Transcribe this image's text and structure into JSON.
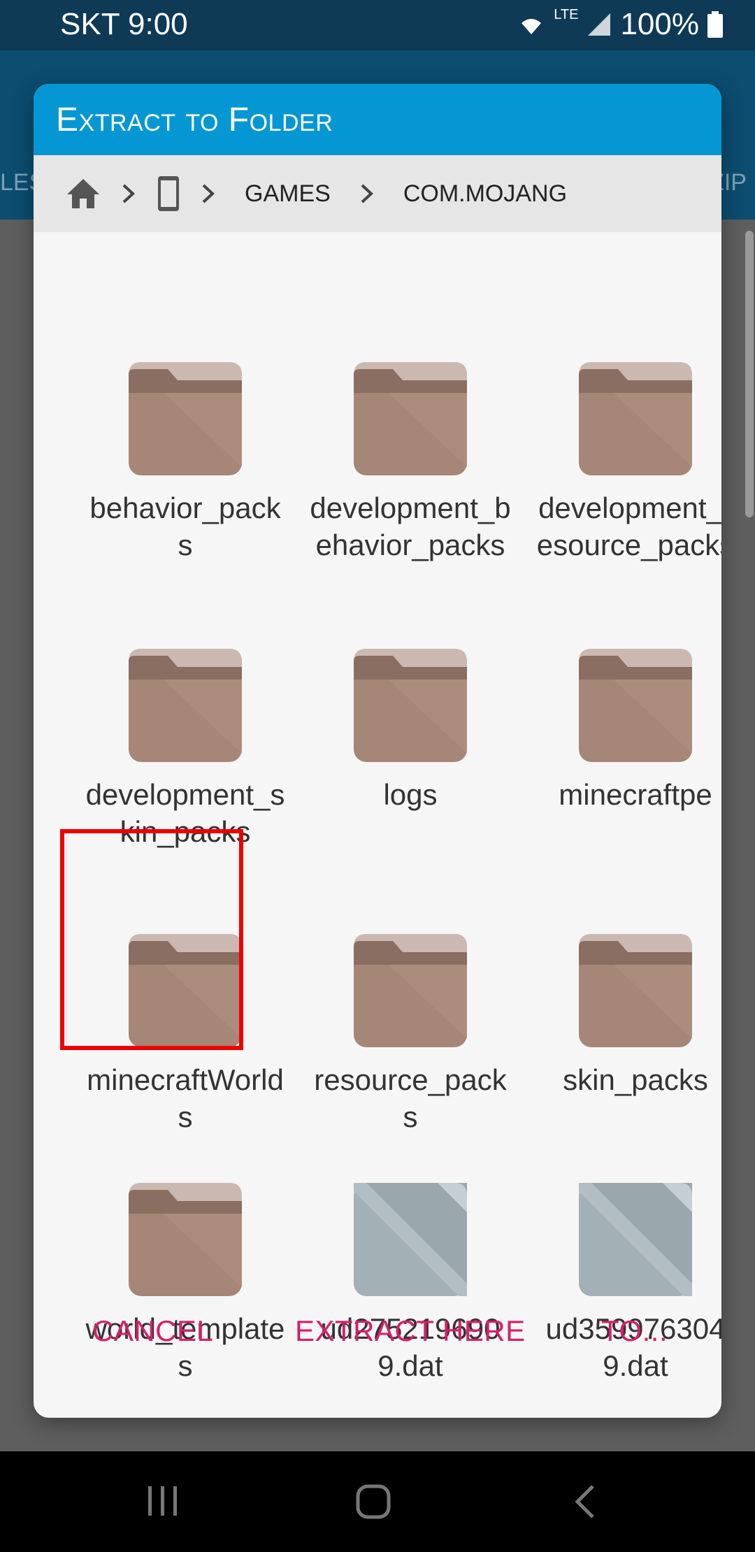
{
  "status_bar": {
    "carrier_time": "SKT 9:00",
    "network": "LTE",
    "battery": "100%"
  },
  "background": {
    "left_edge_text": "LES",
    "right_edge_text": "ZIP"
  },
  "dialog": {
    "title": "Extract to Folder",
    "breadcrumb": [
      "GAMES",
      "COM.MOJANG"
    ],
    "items": [
      {
        "label": "behavior_packs",
        "kind": "folder"
      },
      {
        "label": "development_behavior_packs",
        "kind": "folder"
      },
      {
        "label": "development_resource_packs",
        "kind": "folder"
      },
      {
        "label": "development_skin_packs",
        "kind": "folder"
      },
      {
        "label": "logs",
        "kind": "folder"
      },
      {
        "label": "minecraftpe",
        "kind": "folder"
      },
      {
        "label": "minecraftWorlds",
        "kind": "folder"
      },
      {
        "label": "resource_packs",
        "kind": "folder"
      },
      {
        "label": "skin_packs",
        "kind": "folder"
      },
      {
        "label": "world_templates",
        "kind": "folder"
      },
      {
        "label": "ud2752196909.dat",
        "kind": "file"
      },
      {
        "label": "ud3599763049.dat",
        "kind": "file"
      }
    ],
    "actions": {
      "cancel": "CANCEL",
      "extract_here": "EXTRACT HERE",
      "to": "TO..."
    }
  },
  "colors": {
    "title_bar": "#0597d3",
    "accent": "#d61f69",
    "folder": "#a68676",
    "file": "#a3b0b6",
    "highlight": "#ee0000"
  }
}
